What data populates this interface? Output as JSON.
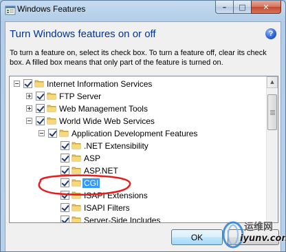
{
  "window": {
    "title": "Windows Features",
    "caption_min": "–",
    "caption_max": "□",
    "caption_close": "✕"
  },
  "header": {
    "heading": "Turn Windows features on or off",
    "help_glyph": "?",
    "description": "To turn a feature on, select its check box. To turn a feature off, clear its check box. A filled box means that only part of the feature is turned on."
  },
  "tree": {
    "items": [
      {
        "label": "Internet Information Services",
        "checked": true,
        "expander": "minus"
      },
      {
        "label": "FTP Server",
        "checked": true,
        "expander": "plus"
      },
      {
        "label": "Web Management Tools",
        "checked": true,
        "expander": "plus"
      },
      {
        "label": "World Wide Web Services",
        "checked": true,
        "expander": "minus"
      },
      {
        "label": "Application Development Features",
        "checked": true,
        "expander": "minus"
      },
      {
        "label": ".NET Extensibility",
        "checked": true,
        "expander": "none"
      },
      {
        "label": "ASP",
        "checked": true,
        "expander": "none"
      },
      {
        "label": "ASP.NET",
        "checked": true,
        "expander": "none"
      },
      {
        "label": "CGI",
        "checked": true,
        "expander": "none",
        "selected": true
      },
      {
        "label": "ISAPI Extensions",
        "checked": true,
        "expander": "none"
      },
      {
        "label": "ISAPI Filters",
        "checked": true,
        "expander": "none"
      },
      {
        "label": "Server-Side Includes",
        "checked": true,
        "expander": "none"
      }
    ]
  },
  "buttons": {
    "ok_label": "OK"
  },
  "watermark": {
    "line1": "运维网",
    "line2": "iyunv.com"
  },
  "colors": {
    "heading": "#003399",
    "selection": "#3399ff",
    "annotation": "#e81c1c",
    "folder": "#e8c15a"
  }
}
